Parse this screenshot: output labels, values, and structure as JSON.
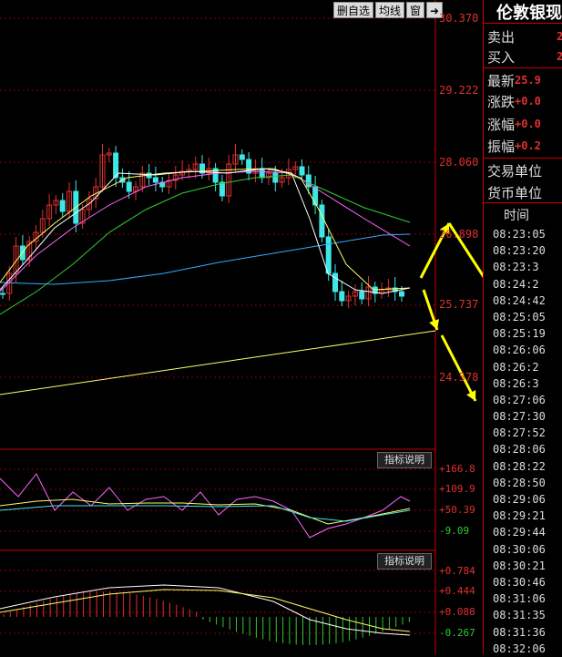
{
  "toolbar": {
    "delete_select": "删自选",
    "avg_line": "均线",
    "window": "窗",
    "arrow": "➜"
  },
  "y_axis": [
    "30.370",
    "29.222",
    "28.060",
    "26.898",
    "25.737",
    "24.578"
  ],
  "indicator1": {
    "button": "指标说明",
    "labels": [
      "+166.8",
      "+109.9",
      "+50.39",
      "-9.09"
    ],
    "label_colors": [
      "#e03030",
      "#e03030",
      "#e03030",
      "#2ec82e"
    ]
  },
  "indicator2": {
    "button": "指标说明",
    "labels": [
      "+0.784",
      "+0.444",
      "+0.088",
      "-0.267"
    ],
    "label_colors": [
      "#e03030",
      "#e03030",
      "#e03030",
      "#2ec82e"
    ]
  },
  "quote": {
    "title": "伦敦银现",
    "sell_label": "卖出",
    "sell_value": "2",
    "buy_label": "买入",
    "buy_value": "2",
    "latest_label": "最新",
    "latest_value": "25.9",
    "change_label": "涨跌",
    "change_value": "+0.0",
    "change_pct_label": "涨幅",
    "change_pct_value": "+0.0",
    "amplitude_label": "振幅",
    "amplitude_value": "+0.2",
    "trade_unit_label": "交易单位",
    "currency_unit_label": "货币单位"
  },
  "ticks": {
    "header": "时间",
    "times": [
      "08:23:05",
      "08:23:20",
      "08:23:3",
      "08:24:2",
      "08:24:42",
      "08:25:05",
      "08:25:19",
      "08:26:06",
      "08:26:2",
      "08:26:3",
      "08:27:06",
      "08:27:30",
      "08:27:52",
      "08:28:06",
      "08:28:22",
      "08:28:50",
      "08:29:06",
      "08:29:21",
      "08:29:44",
      "08:30:06",
      "08:30:21",
      "08:30:46",
      "08:31:06",
      "08:31:35",
      "08:31:36",
      "08:32:06"
    ]
  },
  "colors": {
    "up": "#e03030",
    "down": "#3ee6e6",
    "ma5": "#ffffff",
    "ma10": "#ffff66",
    "ma20": "#ff66ff",
    "ma30": "#33cc33",
    "ma60": "#33aaff",
    "trend": "#ffff66",
    "arrow": "#ffff00"
  }
}
